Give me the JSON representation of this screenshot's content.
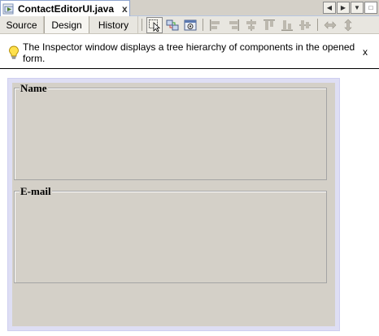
{
  "editor_tab": {
    "title": "ContactEditorUI.java",
    "close_label": "x",
    "icon": "java-file-icon"
  },
  "window_controls": {
    "scroll_left": "◀",
    "scroll_right": "▶",
    "dropdown": "▼",
    "restore": "□"
  },
  "view_tabs": {
    "source": "Source",
    "design": "Design",
    "history": "History",
    "selected": "Design"
  },
  "toolbar_icons": [
    "selection-mode-icon",
    "connection-mode-icon",
    "preview-design-icon",
    "align-left-icon",
    "align-right-icon",
    "center-horizontally-icon",
    "align-top-icon",
    "align-bottom-icon",
    "center-vertically-icon",
    "horizontal-resize-icon",
    "vertical-resize-icon"
  ],
  "info_bar": {
    "icon": "lightbulb-icon",
    "message": "The Inspector window displays a tree hierarchy of components in the opened form.",
    "close_label": "x"
  },
  "form": {
    "panels": [
      {
        "title": "Name"
      },
      {
        "title": "E-mail"
      }
    ]
  },
  "colors": {
    "chrome": "#d4d0c8",
    "designer_border": "#dedef4",
    "tab_border": "#8ea4cf"
  }
}
